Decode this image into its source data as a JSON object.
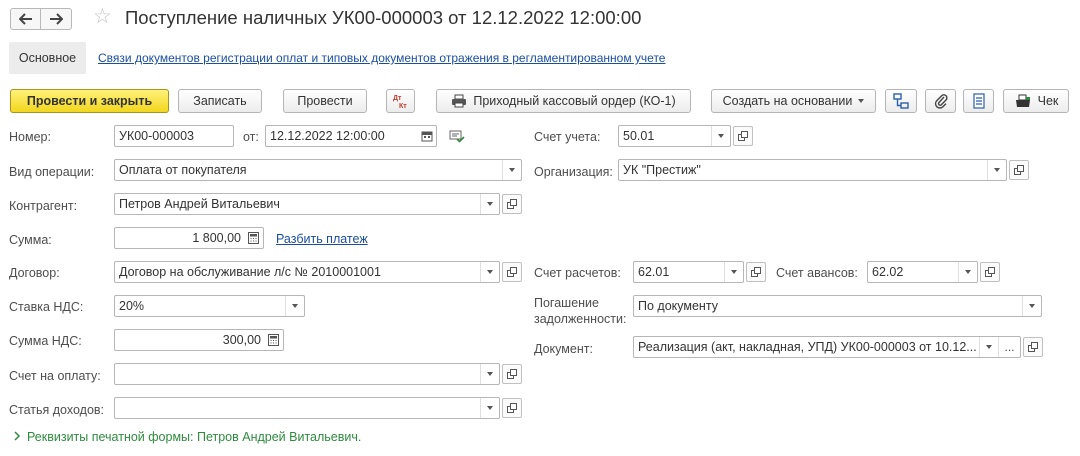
{
  "header": {
    "title": "Поступление наличных УК00-000003 от 12.12.2022 12:00:00",
    "back_icon": "arrow-left-icon",
    "forward_icon": "arrow-right-icon",
    "favorite_icon": "star-icon"
  },
  "sections": {
    "main": "Основное",
    "link": "Связи документов регистрации оплат и типовых документов отражения в регламентированном учете"
  },
  "toolbar": {
    "post_close": "Провести и закрыть",
    "save": "Записать",
    "post": "Провести",
    "dt_kt_icon": "dt-kt-icon",
    "dt_label": "Дт",
    "kt_label": "Кт",
    "receipt_order": "Приходный кассовый ордер (КО-1)",
    "create_based": "Создать на основании",
    "receipt": "Чек"
  },
  "form": {
    "number_label": "Номер:",
    "number_value": "УК00-000003",
    "date_label": "от:",
    "date_value": "12.12.2022 12:00:00",
    "operation_label": "Вид операции:",
    "operation_value": "Оплата от покупателя",
    "counterparty_label": "Контрагент:",
    "counterparty_value": "Петров Андрей Витальевич",
    "amount_label": "Сумма:",
    "amount_value": "1 800,00",
    "split_payment": "Разбить платеж",
    "contract_label": "Договор:",
    "contract_value": "Договор на обслуживание л/с № 2010001001",
    "vat_rate_label": "Ставка НДС:",
    "vat_rate_value": "20%",
    "vat_amount_label": "Сумма НДС:",
    "vat_amount_value": "300,00",
    "invoice_label": "Счет на оплату:",
    "invoice_value": "",
    "income_item_label": "Статья доходов:",
    "income_item_value": "",
    "account_label": "Счет учета:",
    "account_value": "50.01",
    "organization_label": "Организация:",
    "organization_value": "УК \"Престиж\"",
    "settlement_account_label": "Счет расчетов:",
    "settlement_account_value": "62.01",
    "advance_account_label": "Счет авансов:",
    "advance_account_value": "62.02",
    "repayment_label_line1": "Погашение",
    "repayment_label_line2": "задолженности:",
    "repayment_value": "По документу",
    "document_label": "Документ:",
    "document_value": "Реализация (акт, накладная, УПД) УК00-000003 от 10.12...",
    "ellipsis": "..."
  },
  "footer": {
    "print_requisites": "Реквизиты печатной формы: Петров Андрей Витальевич."
  },
  "colors": {
    "primary_button": "#f2d61e",
    "link": "#1a4e9f",
    "footer_link": "#2e8b3e"
  }
}
